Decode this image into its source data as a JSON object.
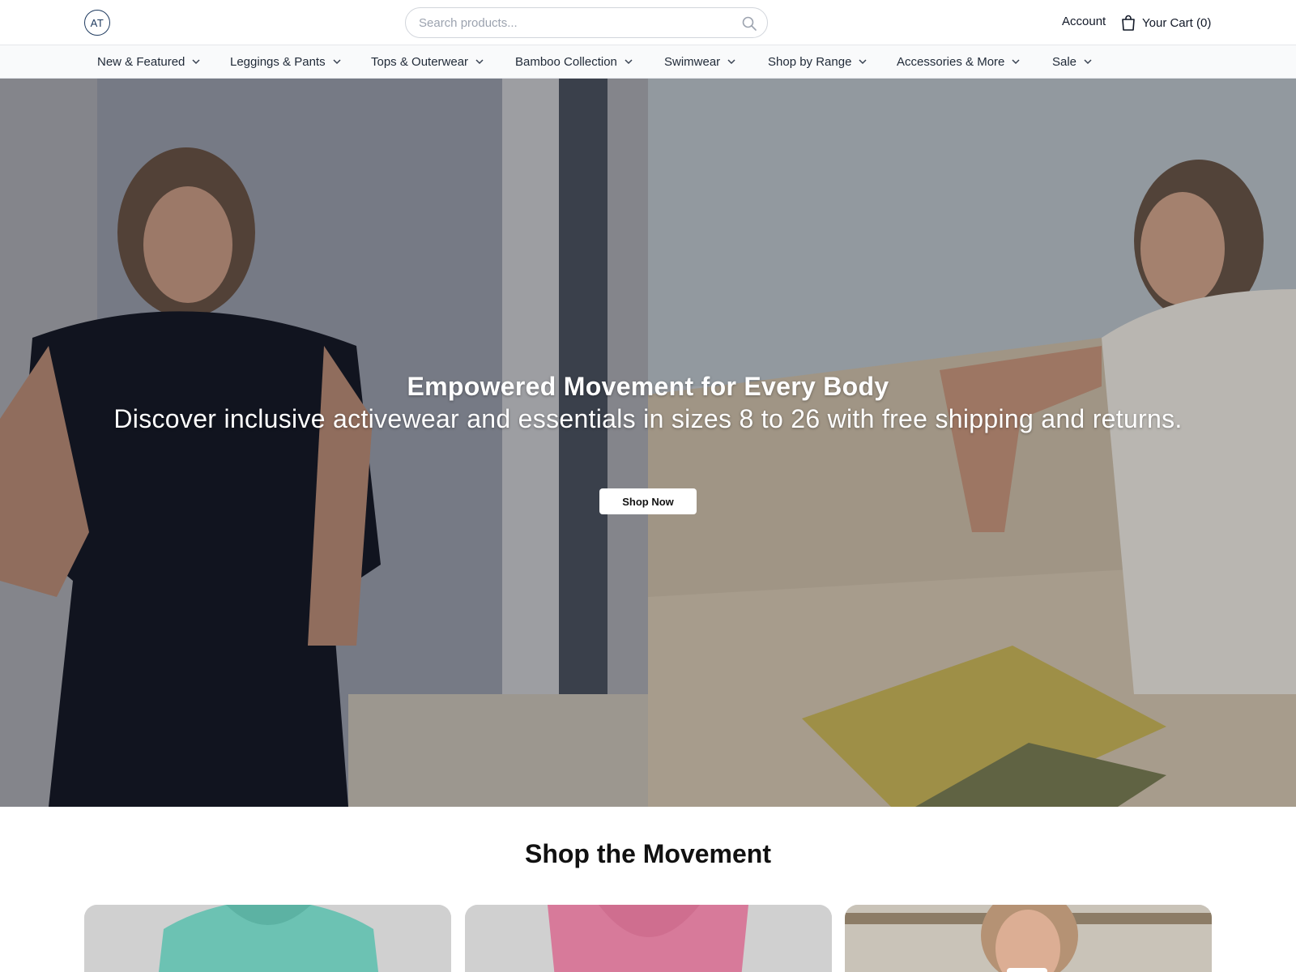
{
  "header": {
    "logo_text": "AT",
    "search_placeholder": "Search products...",
    "account_label": "Account",
    "cart_label": "Your Cart (0)"
  },
  "nav": {
    "items": [
      {
        "label": "New & Featured"
      },
      {
        "label": "Leggings & Pants"
      },
      {
        "label": "Tops & Outerwear"
      },
      {
        "label": "Bamboo Collection"
      },
      {
        "label": "Swimwear"
      },
      {
        "label": "Shop by Range"
      },
      {
        "label": "Accessories & More"
      },
      {
        "label": "Sale"
      }
    ]
  },
  "hero": {
    "title": "Empowered Movement for Every Body",
    "subtitle": "Discover inclusive activewear and essentials in sizes 8 to 26 with free shipping and returns.",
    "cta_label": "Shop Now"
  },
  "section": {
    "title": "Shop the Movement"
  },
  "colors": {
    "brand": "#1e3a5f",
    "card_teal": "#6cc2b3",
    "card_pink": "#d77a9a"
  },
  "icons": [
    "search-icon",
    "bag-icon",
    "chevron-down-icon"
  ]
}
